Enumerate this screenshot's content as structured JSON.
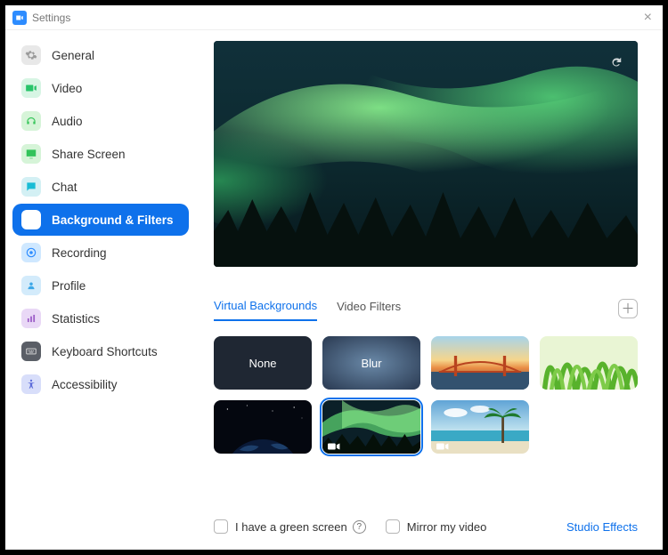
{
  "window": {
    "title": "Settings"
  },
  "sidebar": {
    "items": [
      {
        "label": "General"
      },
      {
        "label": "Video"
      },
      {
        "label": "Audio"
      },
      {
        "label": "Share Screen"
      },
      {
        "label": "Chat"
      },
      {
        "label": "Background & Filters"
      },
      {
        "label": "Recording"
      },
      {
        "label": "Profile"
      },
      {
        "label": "Statistics"
      },
      {
        "label": "Keyboard Shortcuts"
      },
      {
        "label": "Accessibility"
      }
    ],
    "active_index": 5
  },
  "main": {
    "tabs": [
      {
        "label": "Virtual Backgrounds"
      },
      {
        "label": "Video Filters"
      }
    ],
    "active_tab": 0,
    "backgrounds": {
      "none_label": "None",
      "blur_label": "Blur",
      "selected_index": 4
    },
    "footer": {
      "green_screen_label": "I have a green screen",
      "mirror_label": "Mirror my video",
      "studio_label": "Studio Effects"
    }
  }
}
